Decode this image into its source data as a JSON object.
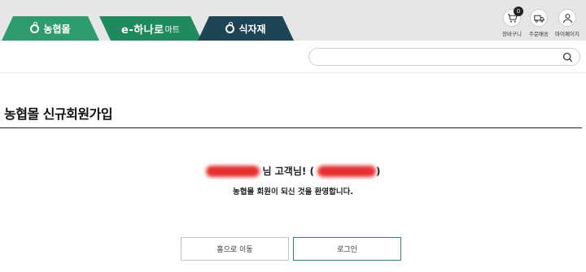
{
  "tabs": [
    {
      "label": "농협몰"
    },
    {
      "label_prefix": "e-하나로",
      "label_suffix": "마트"
    },
    {
      "label": "식자재"
    }
  ],
  "utility": {
    "cart_label": "장바구니",
    "cart_count": "0",
    "order_label": "주문배송",
    "mypage_label": "마이페이지"
  },
  "search": {
    "value": "",
    "placeholder": ""
  },
  "page": {
    "title": "농협몰 신규회원가입"
  },
  "welcome": {
    "suffix": "님 고객님! (",
    "close": ")",
    "message": "농협몰 회원이 되신 것을 환영합니다."
  },
  "buttons": {
    "home": "홈으로 이동",
    "login": "로그인"
  },
  "colors": {
    "tab_nh": "#2e9c6e",
    "tab_hanaro": "#1f8a5e",
    "tab_food": "#1e4556",
    "accent_green": "#2e7d5b"
  }
}
